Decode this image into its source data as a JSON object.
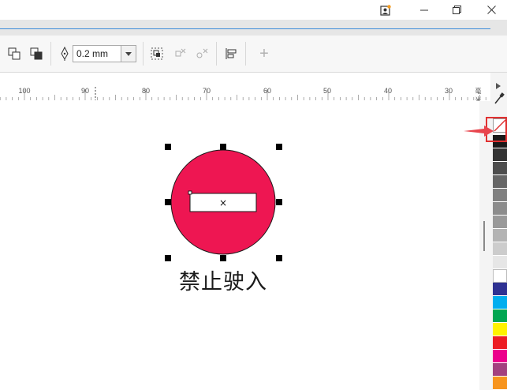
{
  "window": {
    "buttons": [
      "user-icon",
      "minimize-icon",
      "restore-icon",
      "close-icon"
    ]
  },
  "toolbar": {
    "outline_width_value": "0.2 mm",
    "add_label": "+"
  },
  "ruler": {
    "ticks": [
      "100",
      "90",
      "80",
      "70",
      "60",
      "50",
      "40",
      "30"
    ],
    "unit": "毫米"
  },
  "canvas": {
    "sign_caption": "禁止驶入",
    "sign_color": "#ee1652",
    "bar_color": "#ffffff",
    "center_mark": "×"
  },
  "palette": {
    "colors": [
      "#1a1a1a",
      "#333333",
      "#4d4d4d",
      "#666666",
      "#808080",
      "#8c8c8c",
      "#999999",
      "#b3b3b3",
      "#cccccc",
      "#e6e6e6",
      "#ffffff",
      "#2e3192",
      "#00aeef",
      "#00a651",
      "#fff200",
      "#ed1c24",
      "#ec008c",
      "#a3407f",
      "#f7941d"
    ]
  }
}
